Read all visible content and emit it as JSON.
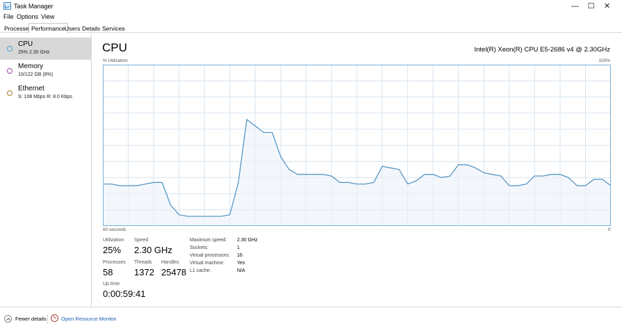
{
  "window": {
    "title": "Task Manager"
  },
  "window_controls": {
    "minimize": "—",
    "maximize": "☐",
    "close": "✕"
  },
  "menu": {
    "file": "File",
    "options": "Options",
    "view": "View"
  },
  "tabs": [
    "Processes",
    "Performance",
    "Users",
    "Details",
    "Services"
  ],
  "sidebar": {
    "items": [
      {
        "title": "CPU",
        "subtitle": "25% 2.30 GHz",
        "color": "#4a9fd1"
      },
      {
        "title": "Memory",
        "subtitle": "10/122 GB (8%)",
        "color": "#9b46a3"
      },
      {
        "title": "Ethernet",
        "subtitle": "S: 108 Mbps  R: 8.0 Kbps",
        "color": "#b07a2a"
      }
    ]
  },
  "main": {
    "title": "CPU",
    "cpu_model": "Intel(R) Xeon(R) CPU E5-2686 v4 @ 2.30GHz",
    "y_label": "% Utilization",
    "y_max_label": "100%",
    "x_left_label": "60 seconds",
    "x_right_label": "0"
  },
  "chart_data": {
    "type": "area",
    "y_range": [
      0,
      100
    ],
    "x_range": [
      60,
      0
    ],
    "grid": true,
    "line_color": "#4a8fc0",
    "fill_color": "#f1f6fb",
    "x": [
      60,
      59,
      58,
      57,
      56,
      55,
      54,
      53,
      52,
      51,
      50,
      49,
      48,
      47,
      46,
      45,
      44,
      43,
      42,
      41,
      40,
      39,
      38,
      37,
      36,
      35,
      34,
      33,
      32,
      31,
      30,
      29,
      28,
      27,
      26,
      25,
      24,
      23,
      22,
      21,
      20,
      19,
      18,
      17,
      16,
      15,
      14,
      13,
      12,
      11,
      10,
      9,
      8,
      7,
      6,
      5,
      4,
      3,
      2,
      1,
      0
    ],
    "values": [
      26,
      26,
      25,
      25,
      25,
      26,
      27,
      27,
      13,
      7,
      6,
      6,
      6,
      6,
      6,
      7,
      27,
      66,
      62,
      58,
      58,
      43,
      35,
      32,
      32,
      32,
      32,
      31,
      27,
      27,
      26,
      26,
      27,
      37,
      36,
      35,
      26,
      28,
      32,
      32,
      30,
      31,
      38,
      38,
      36,
      33,
      32,
      31,
      25,
      25,
      26,
      31,
      31,
      32,
      32,
      30,
      25,
      25,
      29,
      29,
      25
    ]
  },
  "stats": {
    "utilization": {
      "label": "Utilization",
      "value": "25%"
    },
    "speed": {
      "label": "Speed",
      "value": "2.30 GHz"
    },
    "processes": {
      "label": "Processes",
      "value": "58"
    },
    "threads": {
      "label": "Threads",
      "value": "1372"
    },
    "handles": {
      "label": "Handles",
      "value": "25478"
    },
    "uptime": {
      "label": "Up time",
      "value": "0:00:59:41"
    }
  },
  "specs": [
    {
      "key": "Maximum speed:",
      "value": "2.30 GHz"
    },
    {
      "key": "Sockets:",
      "value": "1"
    },
    {
      "key": "Virtual processors:",
      "value": "16"
    },
    {
      "key": "Virtual machine:",
      "value": "Yes"
    },
    {
      "key": "L1 cache:",
      "value": "N/A"
    }
  ],
  "footer": {
    "fewer_details": "Fewer details",
    "open_resource_monitor": "Open Resource Monitor"
  }
}
